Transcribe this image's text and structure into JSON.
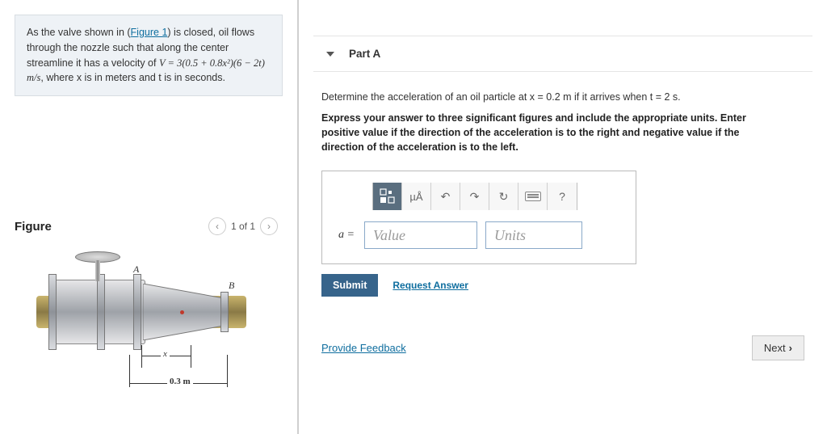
{
  "problem": {
    "prefix": "As the valve shown in (",
    "figure_link": "Figure 1",
    "suffix": ") is closed, oil flows through the nozzle such that along the center streamline it has a velocity of ",
    "equation": "V = 3(0.5 + 0.8x²)(6 − 2t) m/s",
    "tail": ", where x is in meters and t is in seconds."
  },
  "figure": {
    "title": "Figure",
    "counter": "1 of 1",
    "label_A": "A",
    "label_B": "B",
    "dim_x": "x",
    "dim_length": "0.3 m"
  },
  "part": {
    "label": "Part A",
    "question": "Determine the acceleration of an oil particle at x = 0.2 m if it arrives when t = 2 s.",
    "instruction": "Express your answer to three significant figures and include the appropriate units. Enter positive value if the direction of the acceleration is to the right and negative value if the direction of the acceleration is to the left."
  },
  "toolbar": {
    "templates": "templates-icon",
    "units_btn": "µÅ",
    "undo": "↶",
    "redo": "↷",
    "reset": "↻",
    "keyboard": "keyboard-icon",
    "help": "?"
  },
  "answer": {
    "var_label": "a =",
    "value_placeholder": "Value",
    "units_placeholder": "Units"
  },
  "actions": {
    "submit": "Submit",
    "request": "Request Answer",
    "feedback": "Provide Feedback",
    "next": "Next"
  }
}
